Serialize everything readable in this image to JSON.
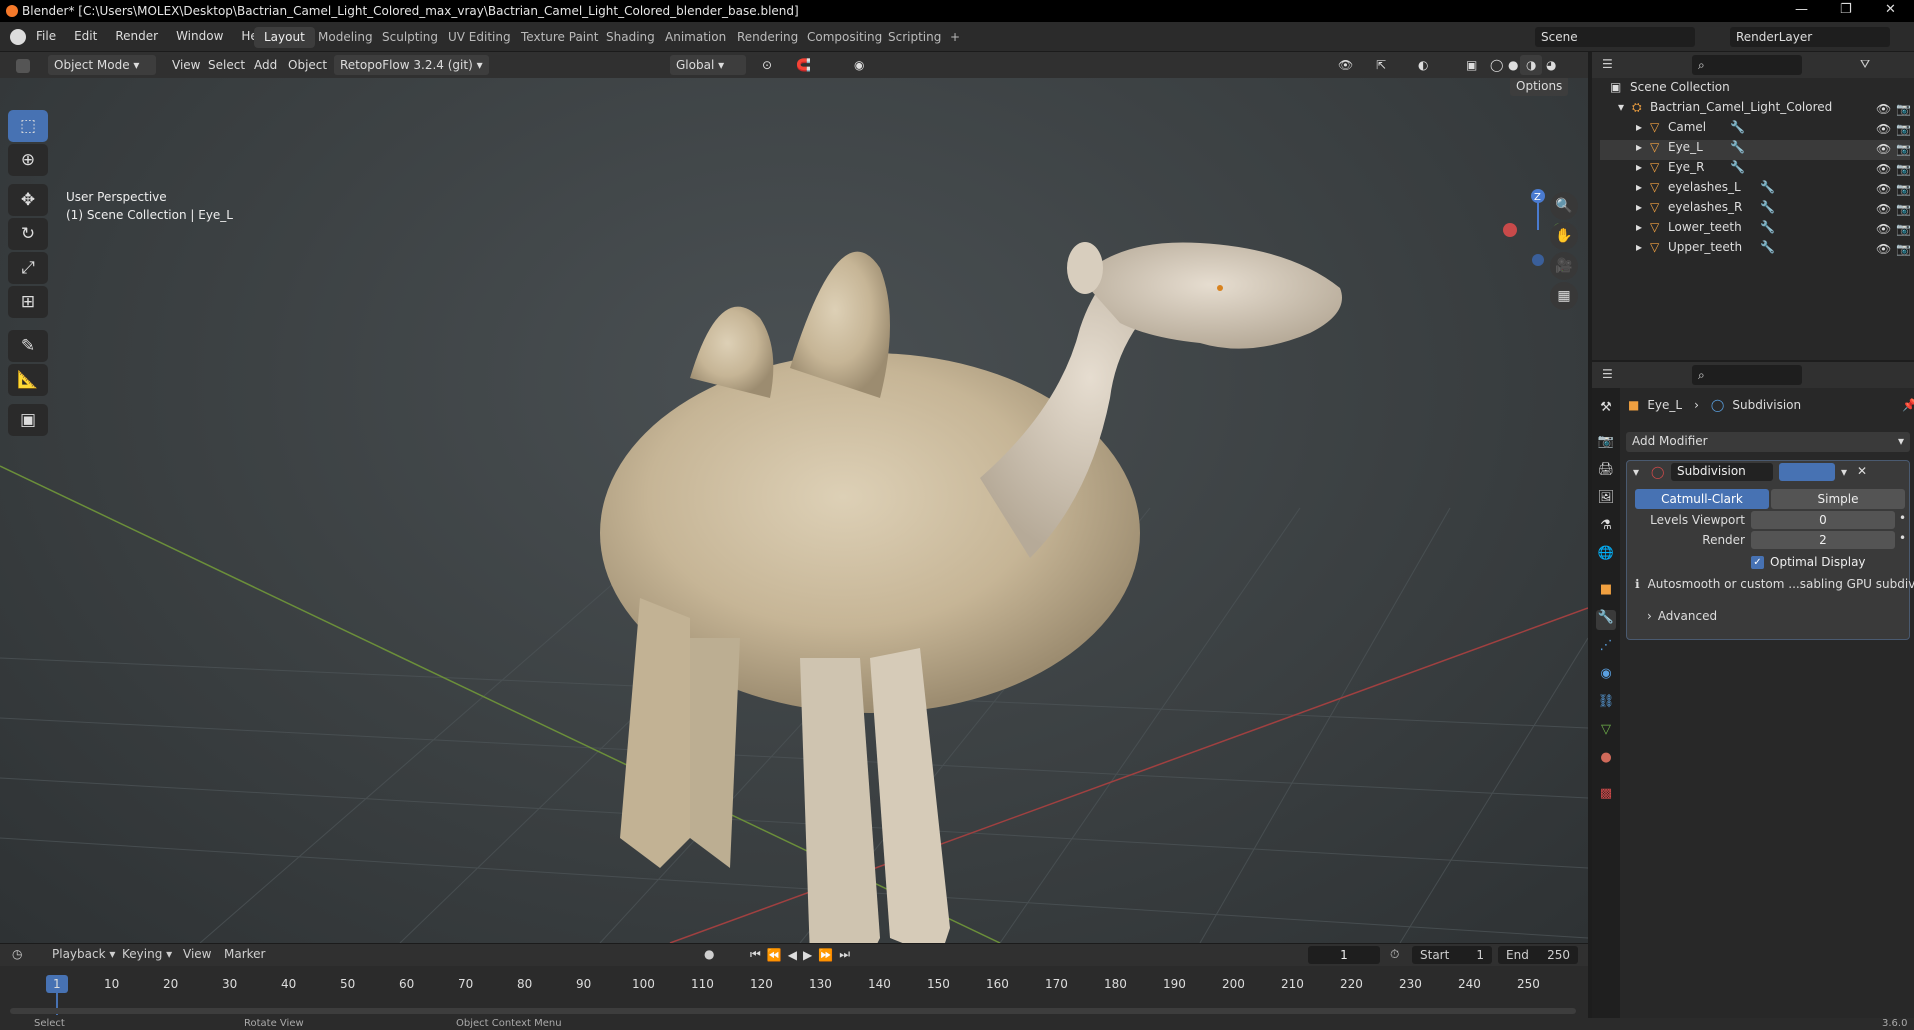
{
  "title_bar": {
    "text": "Blender* [C:\\Users\\MOLEX\\Desktop\\Bactrian_Camel_Light_Colored_max_vray\\Bactrian_Camel_Light_Colored_blender_base.blend]",
    "minimize": "—",
    "restore": "❐",
    "close": "✕"
  },
  "menu": [
    "File",
    "Edit",
    "Render",
    "Window",
    "Help"
  ],
  "workspaces": [
    "Layout",
    "Modeling",
    "Sculpting",
    "UV Editing",
    "Texture Paint",
    "Shading",
    "Animation",
    "Rendering",
    "Compositing",
    "Scripting",
    "+"
  ],
  "active_workspace": "Layout",
  "scene": {
    "name": "Scene",
    "render_layer": "RenderLayer"
  },
  "viewport_header": {
    "mode": "Object Mode",
    "menus": [
      "View",
      "Select",
      "Add",
      "Object"
    ],
    "addon": "RetopoFlow 3.2.4 (git)",
    "orientation": "Global",
    "options": "Options"
  },
  "viewport": {
    "perspective": "User Perspective",
    "collection": "(1) Scene Collection | Eye_L"
  },
  "outliner": {
    "root": "Scene Collection",
    "collection": "Bactrian_Camel_Light_Colored",
    "items": [
      "Camel",
      "Eye_L",
      "Eye_R",
      "eyelashes_L",
      "eyelashes_R",
      "Lower_teeth",
      "Upper_teeth"
    ]
  },
  "properties": {
    "breadcrumb_object": "Eye_L",
    "breadcrumb_modifier": "Subdivision",
    "add_modifier": "Add Modifier",
    "modifier_name": "Subdivision",
    "type_a": "Catmull-Clark",
    "type_b": "Simple",
    "levels_viewport_label": "Levels Viewport",
    "levels_viewport_value": "0",
    "render_label": "Render",
    "render_value": "2",
    "optimal_display": "Optimal Display",
    "info": "Autosmooth or custom ...sabling GPU subdivision",
    "advanced": "Advanced"
  },
  "timeline": {
    "menus": [
      "Playback",
      "Keying",
      "View",
      "Marker"
    ],
    "current_frame": "1",
    "start_label": "Start",
    "start_value": "1",
    "end_label": "End",
    "end_value": "250",
    "ticks": [
      "1",
      "10",
      "20",
      "30",
      "40",
      "50",
      "60",
      "70",
      "80",
      "90",
      "100",
      "110",
      "120",
      "130",
      "140",
      "150",
      "160",
      "170",
      "180",
      "190",
      "200",
      "210",
      "220",
      "230",
      "240",
      "250"
    ]
  },
  "status_bar": {
    "select": "Select",
    "rotate": "Rotate View",
    "context": "Object Context Menu",
    "version": "3.6.0"
  },
  "colors": {
    "accent": "#4772b3",
    "viewport_bg": "#3d4244",
    "camel": "#c8b89a",
    "object_icon": "#f0a040"
  }
}
